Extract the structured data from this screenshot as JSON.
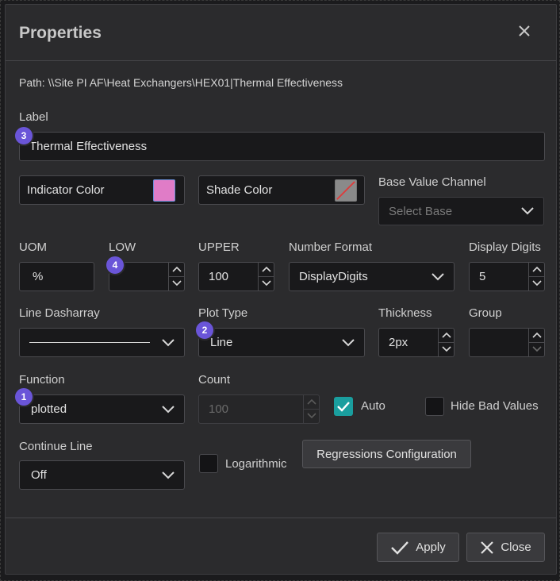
{
  "dialog": {
    "title": "Properties",
    "path": "Path: \\\\Site PI AF\\Heat Exchangers\\HEX01|Thermal Effectiveness"
  },
  "fields": {
    "label": {
      "label": "Label",
      "value": "Thermal Effectiveness",
      "badge": "3"
    },
    "indicator_color": {
      "label": "Indicator Color",
      "color": "#e07cc7"
    },
    "shade_color": {
      "label": "Shade Color",
      "color": "none"
    },
    "base_value_channel": {
      "label": "Base Value Channel",
      "placeholder": "Select Base"
    },
    "uom": {
      "label": "UOM",
      "value": "%"
    },
    "low": {
      "label": "LOW",
      "value": "",
      "badge": "4"
    },
    "upper": {
      "label": "UPPER",
      "value": "100"
    },
    "number_format": {
      "label": "Number Format",
      "value": "DisplayDigits"
    },
    "display_digits": {
      "label": "Display Digits",
      "value": "5"
    },
    "line_dasharray": {
      "label": "Line Dasharray"
    },
    "plot_type": {
      "label": "Plot Type",
      "value": "Line",
      "badge": "2"
    },
    "thickness": {
      "label": "Thickness",
      "value": "2px"
    },
    "group": {
      "label": "Group",
      "value": ""
    },
    "function": {
      "label": "Function",
      "value": "plotted",
      "badge": "1"
    },
    "count": {
      "label": "Count",
      "value": "100"
    },
    "auto": {
      "label": "Auto",
      "checked": true
    },
    "hide_bad_values": {
      "label": "Hide Bad Values",
      "checked": false
    },
    "continue_line": {
      "label": "Continue Line",
      "value": "Off"
    },
    "logarithmic": {
      "label": "Logarithmic",
      "checked": false
    }
  },
  "buttons": {
    "regressions": "Regressions Configuration",
    "apply": "Apply",
    "close": "Close"
  },
  "colors": {
    "accent": "#1a9e9e",
    "badge": "#6a55d8",
    "dialog_bg": "#2b2b2d"
  }
}
